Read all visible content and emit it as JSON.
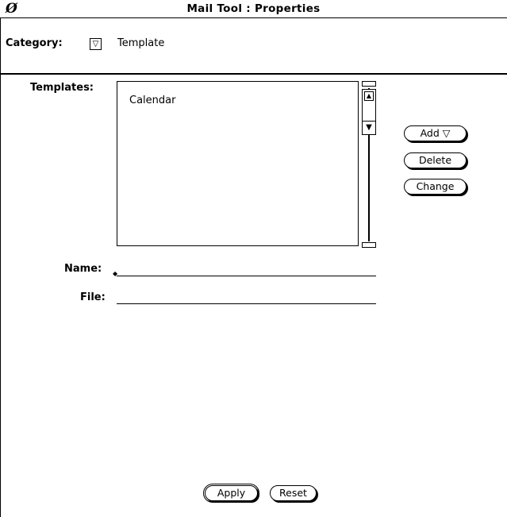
{
  "window": {
    "title": "Mail Tool : Properties",
    "menu_glyph": "Ø"
  },
  "category": {
    "label": "Category:",
    "menu_glyph": "▽",
    "value": "Template"
  },
  "templates": {
    "label": "Templates:",
    "items": [
      "Calendar"
    ]
  },
  "scrollbar": {
    "up_glyph": "▲",
    "down_glyph": "▼"
  },
  "buttons": {
    "add": "Add  ▽",
    "delete": "Delete",
    "change": "Change",
    "apply": "Apply",
    "reset": "Reset"
  },
  "fields": {
    "name_label": "Name:",
    "name_value": "",
    "file_label": "File:",
    "file_value": ""
  }
}
